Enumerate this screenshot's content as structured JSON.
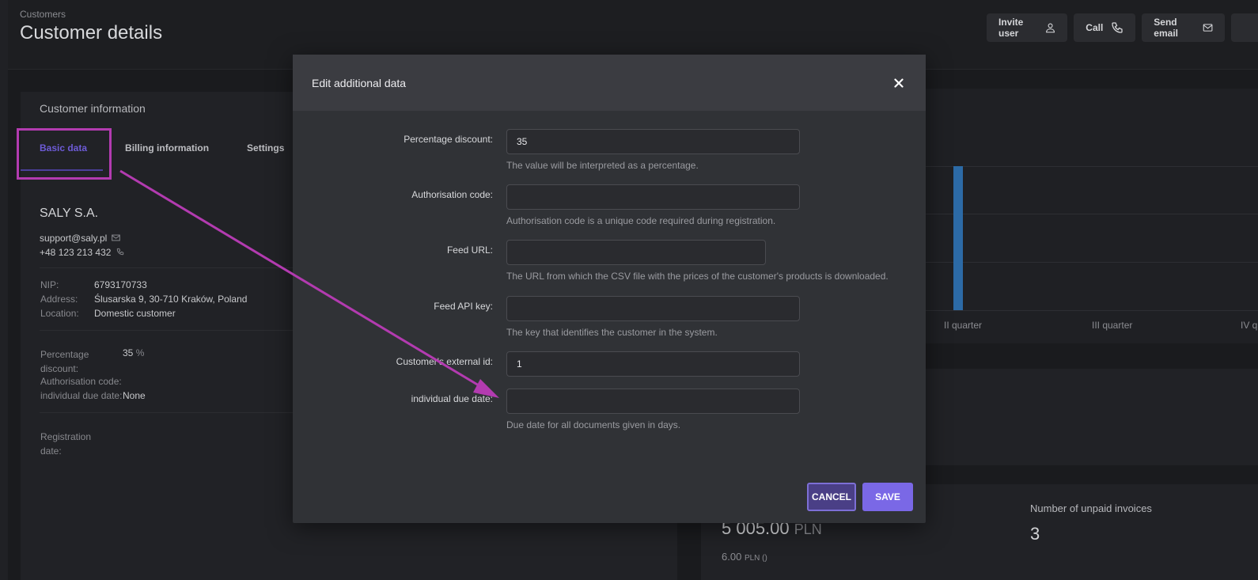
{
  "header": {
    "breadcrumb": "Customers",
    "title": "Customer details",
    "actions": {
      "invite_user": "Invite user",
      "call": "Call",
      "send_email": "Send email"
    }
  },
  "customer_card": {
    "title": "Customer information",
    "tabs": [
      "Basic data",
      "Billing information",
      "Settings"
    ],
    "active_tab": "Basic data",
    "company_name": "SALY S.A.",
    "email": "support@saly.pl",
    "phone": "+48 123 213 432",
    "details": [
      {
        "label": "NIP:",
        "value": "6793170733"
      },
      {
        "label": "Address:",
        "value": "Ślusarska 9, 30-710 Kraków, Poland"
      },
      {
        "label": "Location:",
        "value": "Domestic customer"
      }
    ],
    "extra": {
      "percentage_label": "Percentage discount:",
      "percentage_value": "35",
      "percentage_unit": "%",
      "auth_label": "Authorisation code:",
      "due_label": "individual due date:",
      "due_value": "None"
    },
    "registration_label": "Registration date:"
  },
  "chart": {
    "quarters": [
      "II quarter",
      "III quarter",
      "IV q"
    ]
  },
  "summary": {
    "amount": "5 005.00",
    "currency": "PLN",
    "amount_secondary": "6.00",
    "secondary_currency": "PLN ()",
    "unpaid_label": "Number of unpaid invoices",
    "unpaid_value": "3"
  },
  "modal": {
    "title": "Edit additional data",
    "fields": {
      "percentage_discount": {
        "label": "Percentage discount:",
        "value": "35",
        "help": "The value will be interpreted as a percentage."
      },
      "authorisation_code": {
        "label": "Authorisation code:",
        "value": "",
        "help": "Authorisation code is a unique code required during registration."
      },
      "feed_url": {
        "label": "Feed URL:",
        "value": "",
        "help": "The URL from which the CSV file with the prices of the customer's products is downloaded."
      },
      "feed_api_key": {
        "label": "Feed API key:",
        "value": "",
        "help": "The key that identifies the customer in the system."
      },
      "external_id": {
        "label": "Customer's external id:",
        "value": "1"
      },
      "due_date": {
        "label": "individual due date:",
        "value": "",
        "help": "Due date for all documents given in days."
      }
    },
    "cancel_label": "CANCEL",
    "save_label": "SAVE"
  },
  "colors": {
    "accent": "#7a68e6",
    "highlight": "#b33bb0"
  }
}
